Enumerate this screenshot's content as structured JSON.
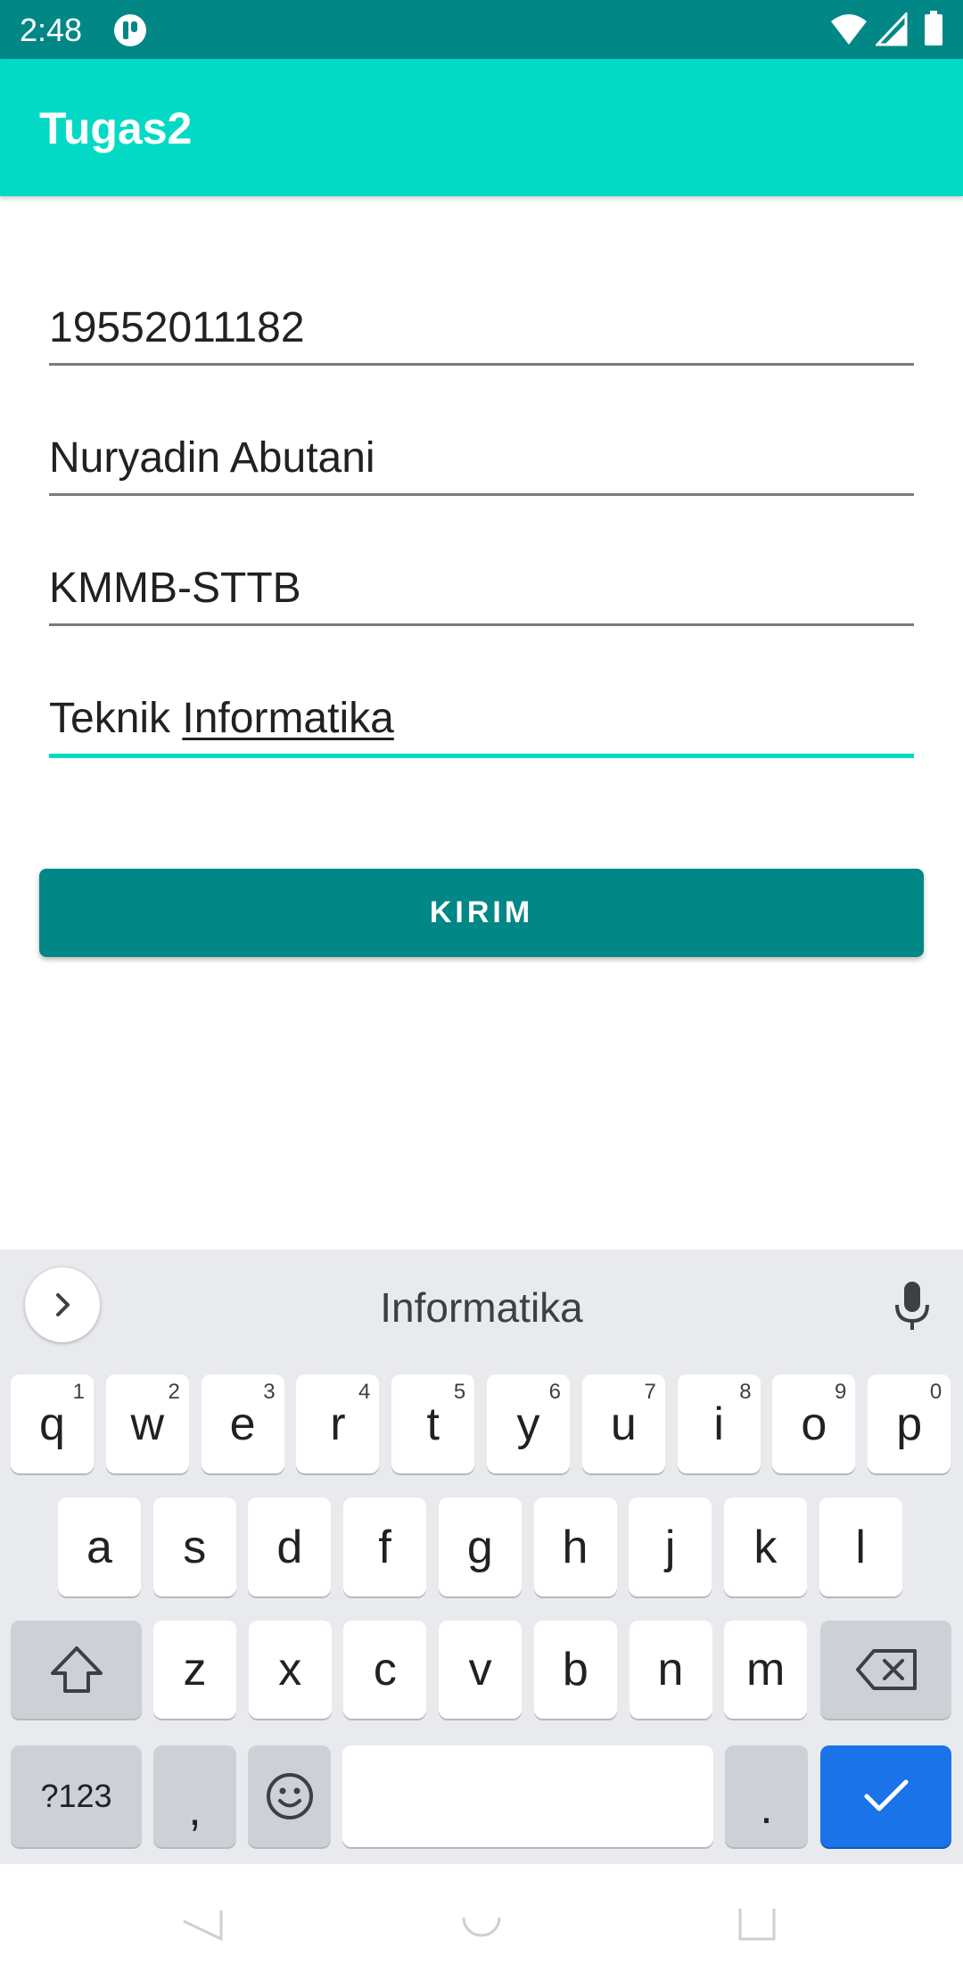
{
  "status_bar": {
    "time": "2:48"
  },
  "app_bar": {
    "title": "Tugas2"
  },
  "form": {
    "nim": "19552011182",
    "name": "Nuryadin Abutani",
    "class": "KMMB-STTB",
    "major_prefix": "Teknik ",
    "major_composing": "Informatika"
  },
  "submit_button": {
    "label": "KIRIM"
  },
  "keyboard": {
    "suggestion": "Informatika",
    "row1": [
      {
        "k": "q",
        "h": "1"
      },
      {
        "k": "w",
        "h": "2"
      },
      {
        "k": "e",
        "h": "3"
      },
      {
        "k": "r",
        "h": "4"
      },
      {
        "k": "t",
        "h": "5"
      },
      {
        "k": "y",
        "h": "6"
      },
      {
        "k": "u",
        "h": "7"
      },
      {
        "k": "i",
        "h": "8"
      },
      {
        "k": "o",
        "h": "9"
      },
      {
        "k": "p",
        "h": "0"
      }
    ],
    "row2": [
      "a",
      "s",
      "d",
      "f",
      "g",
      "h",
      "j",
      "k",
      "l"
    ],
    "row3": [
      "z",
      "x",
      "c",
      "v",
      "b",
      "n",
      "m"
    ],
    "symbols_label": "?123",
    "comma": ",",
    "period": ".",
    "accent_color": "#1A73E8"
  },
  "colors": {
    "primary": "#03DAC5",
    "primary_dark": "#018786"
  }
}
